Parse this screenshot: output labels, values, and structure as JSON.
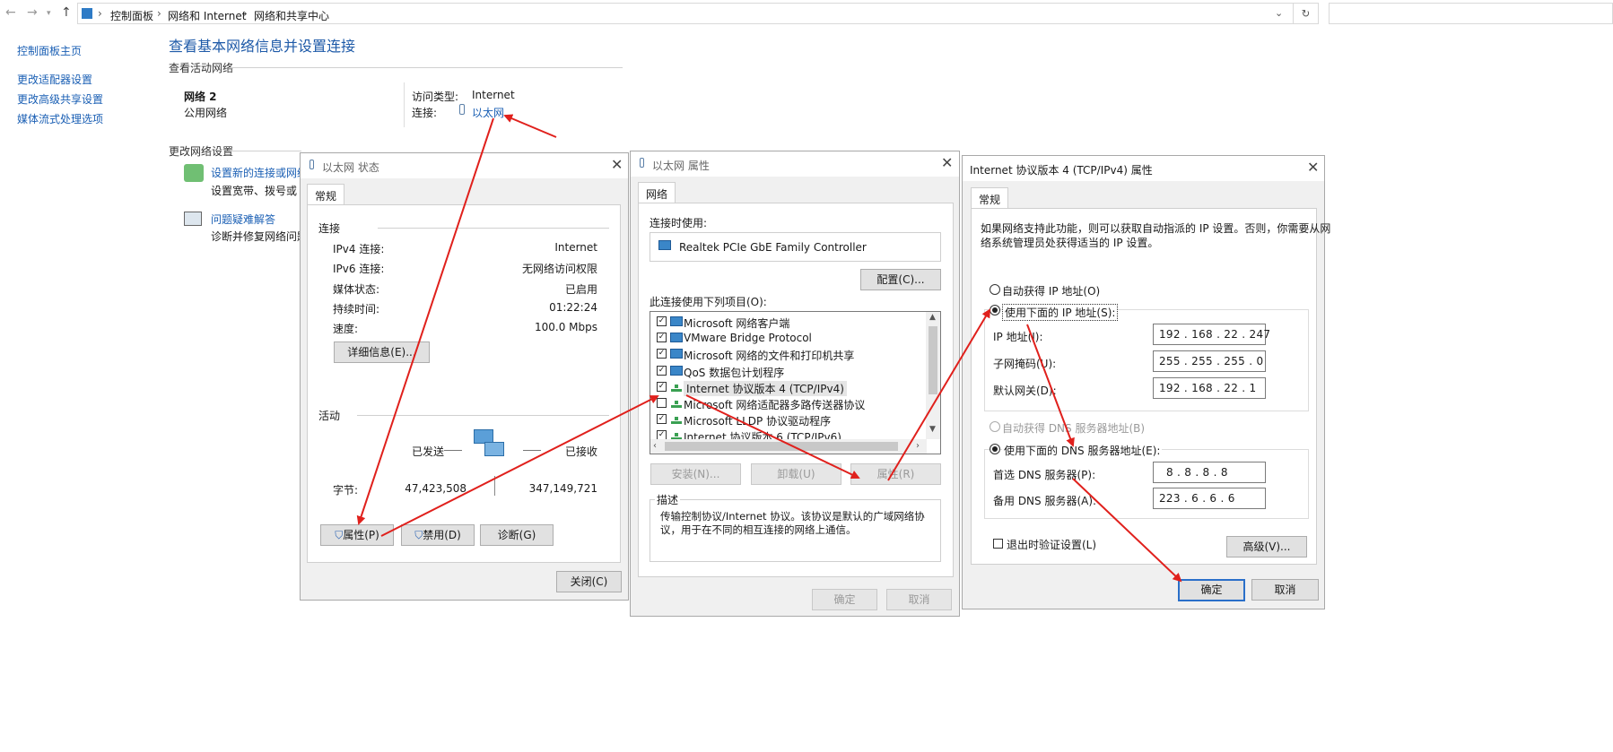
{
  "address": {
    "crumbs": [
      "控制面板",
      "网络和 Internet",
      "网络和共享中心"
    ]
  },
  "sidebar": {
    "items": [
      "控制面板主页",
      "更改适配器设置",
      "更改高级共享设置",
      "媒体流式处理选项"
    ]
  },
  "main": {
    "title": "查看基本网络信息并设置连接",
    "active_networks_label": "查看活动网络",
    "network_name": "网络 2",
    "network_type": "公用网络",
    "access_type_label": "访问类型:",
    "access_type_value": "Internet",
    "connections_label": "连接:",
    "connections_value": "以太网",
    "change_settings_label": "更改网络设置",
    "setup_link": "设置新的连接或网络",
    "setup_desc": "设置宽带、拨号或 VP",
    "troubleshoot_link": "问题疑难解答",
    "troubleshoot_desc": "诊断并修复网络问题,"
  },
  "status_dialog": {
    "title": "以太网 状态",
    "tab": "常规",
    "connection_group": "连接",
    "rows": [
      {
        "label": "IPv4 连接:",
        "value": "Internet"
      },
      {
        "label": "IPv6 连接:",
        "value": "无网络访问权限"
      },
      {
        "label": "媒体状态:",
        "value": "已启用"
      },
      {
        "label": "持续时间:",
        "value": "01:22:24"
      },
      {
        "label": "速度:",
        "value": "100.0 Mbps"
      }
    ],
    "details_button": "详细信息(E)...",
    "activity_group": "活动",
    "sent_label": "已发送",
    "received_label": "已接收",
    "bytes_label": "字节:",
    "bytes_sent": "47,423,508",
    "bytes_received": "347,149,721",
    "properties_button": "属性(P)",
    "disable_button": "禁用(D)",
    "diagnose_button": "诊断(G)",
    "close_button": "关闭(C)"
  },
  "props_dialog": {
    "title": "以太网 属性",
    "tab": "网络",
    "connect_using_label": "连接时使用:",
    "adapter": "Realtek PCIe GbE Family Controller",
    "configure_button": "配置(C)...",
    "items_label": "此连接使用下列项目(O):",
    "items": [
      {
        "label": "Microsoft 网络客户端",
        "checked": true,
        "icon": "network-client-icon"
      },
      {
        "label": "VMware Bridge Protocol",
        "checked": true,
        "icon": "network-client-icon"
      },
      {
        "label": "Microsoft 网络的文件和打印机共享",
        "checked": true,
        "icon": "network-client-icon"
      },
      {
        "label": "QoS 数据包计划程序",
        "checked": true,
        "icon": "network-client-icon"
      },
      {
        "label": "Internet 协议版本 4 (TCP/IPv4)",
        "checked": true,
        "icon": "protocol-icon"
      },
      {
        "label": "Microsoft 网络适配器多路传送器协议",
        "checked": false,
        "icon": "protocol-icon"
      },
      {
        "label": "Microsoft LLDP 协议驱动程序",
        "checked": true,
        "icon": "protocol-icon"
      },
      {
        "label": "Internet 协议版本 6 (TCP/IPv6)",
        "checked": true,
        "icon": "protocol-icon"
      }
    ],
    "install_button": "安装(N)...",
    "uninstall_button": "卸载(U)",
    "properties_button": "属性(R)",
    "description_group": "描述",
    "description": "传输控制协议/Internet 协议。该协议是默认的广域网络协议，用于在不同的相互连接的网络上通信。",
    "ok_button": "确定",
    "cancel_button": "取消"
  },
  "ipv4_dialog": {
    "title": "Internet 协议版本 4 (TCP/IPv4) 属性",
    "tab": "常规",
    "intro_line1": "如果网络支持此功能，则可以获取自动指派的 IP 设置。否则，你需要从网",
    "intro_line2": "络系统管理员处获得适当的 IP 设置。",
    "auto_ip": "自动获得 IP 地址(O)",
    "manual_ip": "使用下面的 IP 地址(S):",
    "ip_label": "IP 地址(I):",
    "ip_value": "192 . 168 . 22 . 247",
    "mask_label": "子网掩码(U):",
    "mask_value": "255 . 255 . 255 . 0",
    "gateway_label": "默认网关(D):",
    "gateway_value": "192 . 168 . 22 . 1",
    "auto_dns": "自动获得 DNS 服务器地址(B)",
    "manual_dns": "使用下面的 DNS 服务器地址(E):",
    "dns1_label": "首选 DNS 服务器(P):",
    "dns1_value": "8 . 8 . 8 . 8",
    "dns2_label": "备用 DNS 服务器(A):",
    "dns2_value": "223 . 6 . 6 . 6",
    "validate": "退出时验证设置(L)",
    "advanced_button": "高级(V)...",
    "ok_button": "确定",
    "cancel_button": "取消"
  },
  "colors": {
    "link": "#1a5fb4",
    "arrow": "#e0201c",
    "dialog_bg": "#f0f0f0"
  }
}
